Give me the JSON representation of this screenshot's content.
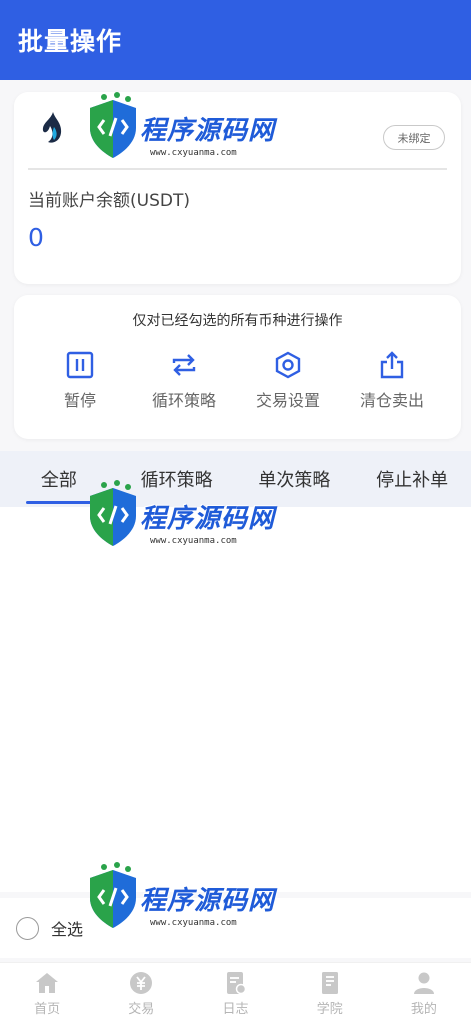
{
  "header": {
    "title": "批量操作"
  },
  "account": {
    "bind_status": "未绑定",
    "balance_label": "当前账户余额(USDT)",
    "balance_value": "0"
  },
  "operations": {
    "hint": "仅对已经勾选的所有币种进行操作",
    "items": [
      {
        "label": "暂停",
        "icon": "pause-icon"
      },
      {
        "label": "循环策略",
        "icon": "repeat-icon"
      },
      {
        "label": "交易设置",
        "icon": "hexagon-settings-icon"
      },
      {
        "label": "清仓卖出",
        "icon": "share-export-icon"
      }
    ]
  },
  "tabs": [
    {
      "label": "全部",
      "active": true
    },
    {
      "label": "循环策略",
      "active": false
    },
    {
      "label": "单次策略",
      "active": false
    },
    {
      "label": "停止补单",
      "active": false
    }
  ],
  "select_all": {
    "label": "全选"
  },
  "tabbar": [
    {
      "label": "首页",
      "icon": "home-icon"
    },
    {
      "label": "交易",
      "icon": "currency-icon"
    },
    {
      "label": "日志",
      "icon": "log-icon"
    },
    {
      "label": "学院",
      "icon": "book-icon"
    },
    {
      "label": "我的",
      "icon": "user-icon"
    }
  ],
  "watermark": {
    "text": "程序源码网",
    "url": "www.cxyuanma.com"
  },
  "colors": {
    "primary": "#2f5fe3",
    "tab_bg": "#eef1f8",
    "inactive": "#b5b5b5"
  }
}
